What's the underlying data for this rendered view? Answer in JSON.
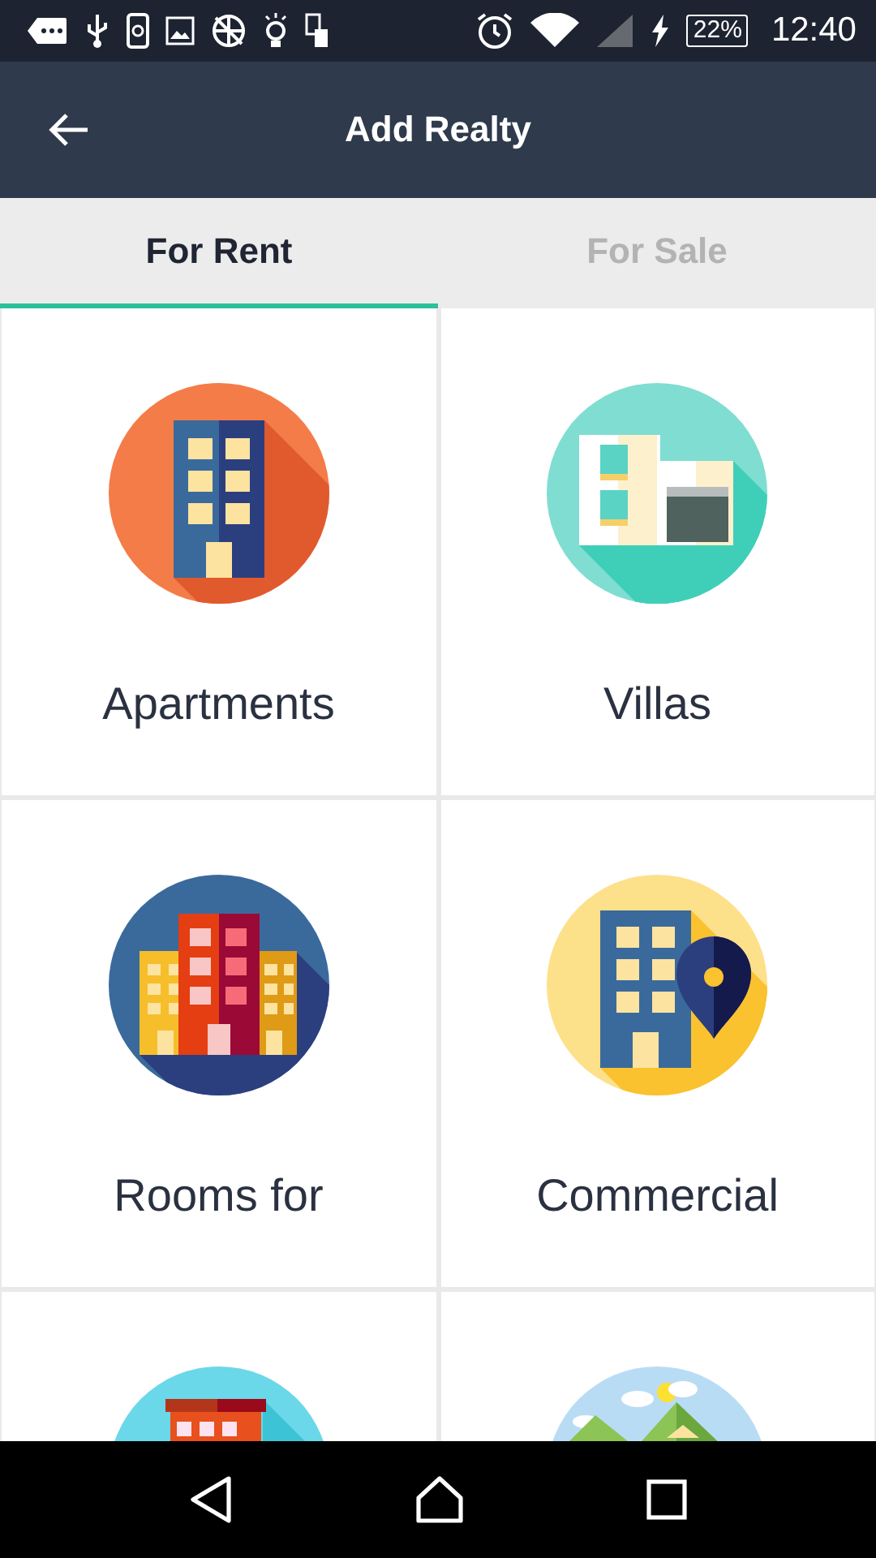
{
  "status_bar": {
    "battery": "22%",
    "time": "12:40"
  },
  "app_bar": {
    "title": "Add Realty"
  },
  "tabs": [
    {
      "label": "For Rent",
      "selected": true
    },
    {
      "label": "For Sale",
      "selected": false
    }
  ],
  "categories": [
    {
      "kind": "apartment",
      "label": "Apartments"
    },
    {
      "kind": "villa",
      "label": "Villas"
    },
    {
      "kind": "rooms",
      "label": "Rooms for"
    },
    {
      "kind": "commercial",
      "label": "Commercial"
    },
    {
      "kind": "shop"
    },
    {
      "kind": "land"
    }
  ]
}
